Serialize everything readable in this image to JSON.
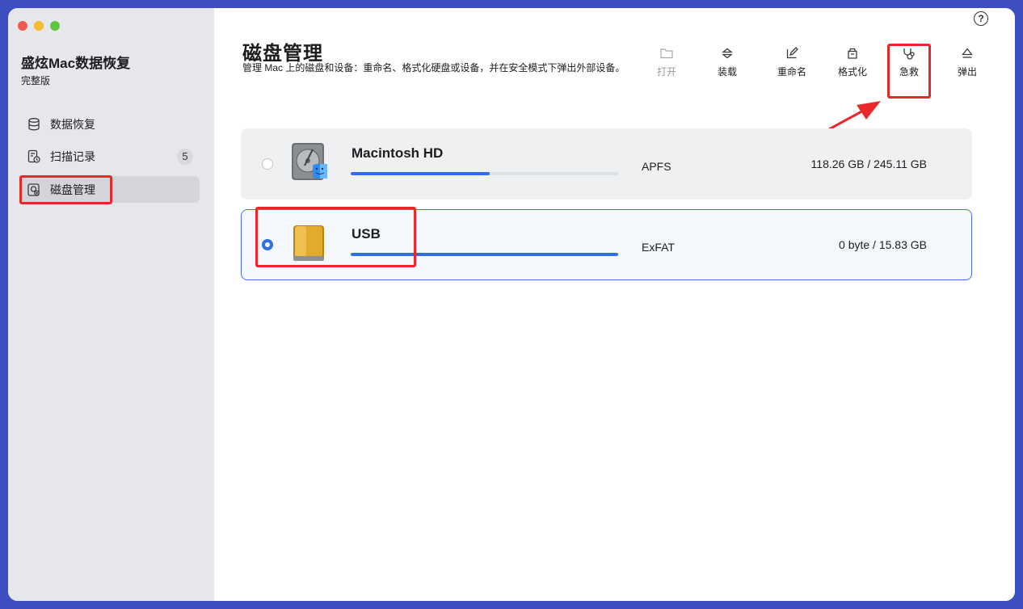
{
  "app": {
    "name": "盛炫Mac数据恢复",
    "edition": "完整版"
  },
  "sidebar": {
    "items": [
      {
        "label": "数据恢复",
        "icon": "database-icon"
      },
      {
        "label": "扫描记录",
        "icon": "scan-history-icon",
        "badge": "5"
      },
      {
        "label": "磁盘管理",
        "icon": "disk-management-icon",
        "active": true
      }
    ]
  },
  "header": {
    "title": "磁盘管理",
    "description": "管理 Mac 上的磁盘和设备：重命名、格式化硬盘或设备，并在安全模式下弹出外部设备。",
    "help": "?"
  },
  "toolbar": {
    "open": "打开",
    "mount": "装载",
    "rename": "重命名",
    "format": "格式化",
    "rescue": "急救",
    "eject": "弹出"
  },
  "disks": [
    {
      "name": "Macintosh HD",
      "filesystem": "APFS",
      "capacity": "118.26 GB / 245.11 GB",
      "used_fraction": 0.52,
      "selected": false,
      "icon": "internal-hard-drive-icon"
    },
    {
      "name": "USB",
      "filesystem": "ExFAT",
      "capacity": "0 byte / 15.83 GB",
      "used_fraction": 1.0,
      "selected": true,
      "icon": "external-drive-icon"
    }
  ],
  "colors": {
    "accent": "#2f6fe3",
    "highlight": "#e8282c",
    "frame": "#3d4fc0"
  }
}
